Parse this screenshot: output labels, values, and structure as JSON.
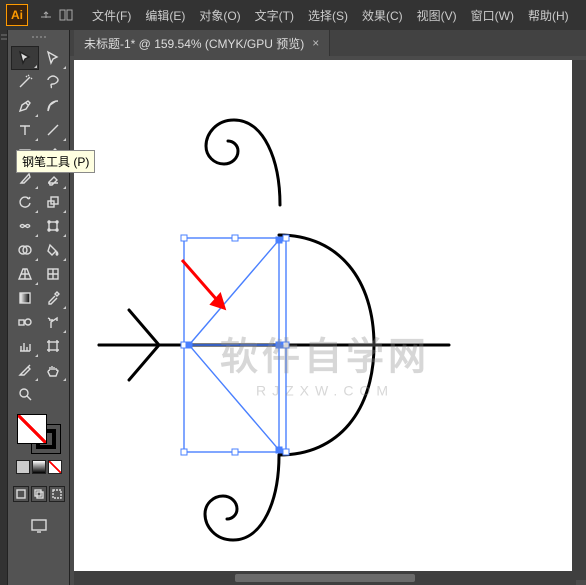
{
  "app": {
    "logo_text": "Ai"
  },
  "menu": {
    "file": "文件(F)",
    "edit": "编辑(E)",
    "object": "对象(O)",
    "type": "文字(T)",
    "select": "选择(S)",
    "effect": "效果(C)",
    "view": "视图(V)",
    "window": "窗口(W)",
    "help": "帮助(H)"
  },
  "tab": {
    "label": "未标题-1* @ 159.54% (CMYK/GPU 预览)",
    "close": "×"
  },
  "tooltip": {
    "pen": "钢笔工具 (P)"
  },
  "watermark": {
    "line1": "软件自学网",
    "line2": "RJZXW.COM"
  },
  "icons": {
    "selection": "selection-icon",
    "direct": "direct-selection-icon",
    "wand": "magic-wand-icon",
    "lasso": "lasso-icon",
    "pen": "pen-icon",
    "curvature": "curvature-icon",
    "type": "type-icon",
    "line": "line-icon",
    "rect": "rectangle-icon",
    "brush": "paintbrush-icon",
    "pencil": "pencil-icon",
    "shaper": "shaper-icon",
    "eraser": "eraser-icon",
    "rotate": "rotate-icon",
    "scale": "scale-icon",
    "width": "width-icon",
    "free": "free-transform-icon",
    "shapebuilder": "shape-builder-icon",
    "perspective": "perspective-icon",
    "mesh": "mesh-icon",
    "gradient": "gradient-icon",
    "eyedrop": "eyedropper-icon",
    "measure": "measure-icon",
    "blend": "blend-icon",
    "symbol": "symbol-sprayer-icon",
    "graph": "graph-icon",
    "artboard": "artboard-icon",
    "slice": "slice-icon",
    "hand": "hand-icon",
    "zoom": "zoom-icon"
  },
  "colors": {
    "accent": "#ff9a00",
    "stroke": "#000000",
    "selection": "#4a80ff",
    "handle": "#4a80ff",
    "arrow": "#ff0000"
  }
}
